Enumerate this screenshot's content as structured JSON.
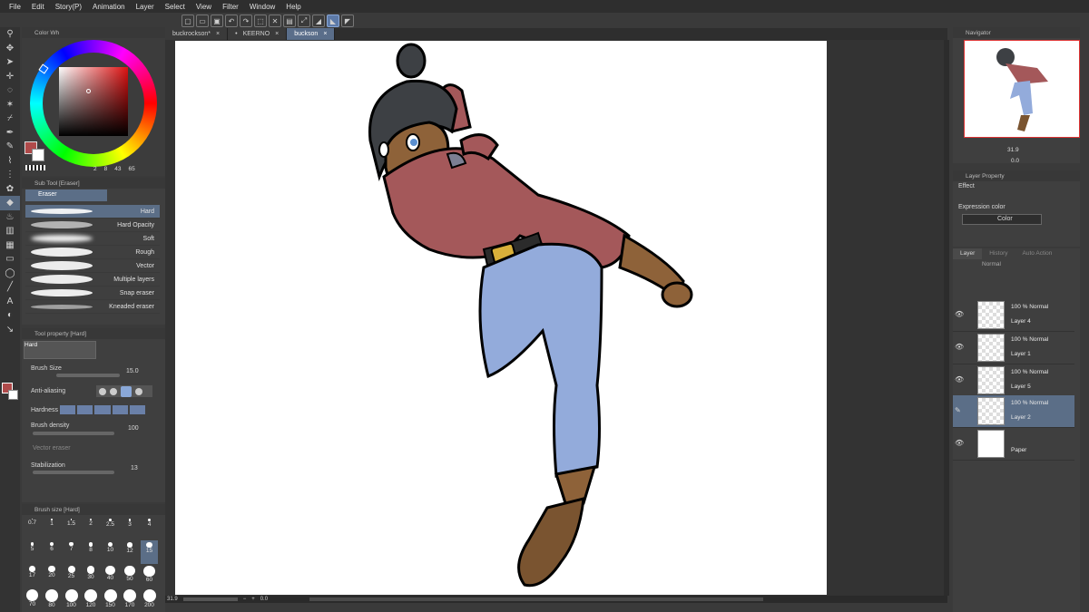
{
  "menu": [
    "File",
    "Edit",
    "Story(P)",
    "Animation",
    "Layer",
    "Select",
    "View",
    "Filter",
    "Window",
    "Help"
  ],
  "color_panel": {
    "title": "Color Wh",
    "values": [
      "2",
      "8",
      "43",
      "65"
    ]
  },
  "sub_tool": {
    "title": "Sub Tool [Eraser]",
    "group": "Eraser",
    "items": [
      "Hard",
      "Hard Opacity",
      "Soft",
      "Rough",
      "Vector",
      "Multiple layers",
      "Snap eraser",
      "Kneaded eraser"
    ]
  },
  "tool_property": {
    "title": "Tool property [Hard]",
    "preset": "Hard",
    "brush_size_label": "Brush Size",
    "brush_size_value": "15.0",
    "anti_aliasing_label": "Anti-aliasing",
    "hardness_label": "Hardness",
    "brush_density_label": "Brush density",
    "brush_density_value": "100",
    "vector_eraser_label": "Vector eraser",
    "stabilization_label": "Stabilization",
    "stabilization_value": "13"
  },
  "brush_size": {
    "title": "Brush size [Hard]",
    "sizes": [
      "0.7",
      "1",
      "1.5",
      "2",
      "2.5",
      "3",
      "4",
      "5",
      "6",
      "7",
      "8",
      "10",
      "12",
      "15",
      "17",
      "20",
      "25",
      "30",
      "40",
      "50",
      "60",
      "70",
      "80",
      "100",
      "120",
      "150",
      "170",
      "200"
    ],
    "selected": "15"
  },
  "tabs": [
    {
      "label": "buckrockson*"
    },
    {
      "label": "KEERNO"
    },
    {
      "label": "buckson"
    }
  ],
  "status": {
    "zoom": "31.9",
    "rotation": "0.0"
  },
  "navigator": {
    "title": "Navigator",
    "zoom": "31.9",
    "rotation": "0.0"
  },
  "layer_property": {
    "title": "Layer Property",
    "effect_label": "Effect",
    "expression_label": "Expression color",
    "expression_value": "Color"
  },
  "layer_panel": {
    "tabs": [
      "Layer",
      "History",
      "Auto Action"
    ],
    "blend": "Normal"
  },
  "layers": [
    {
      "mode": "100 % Normal",
      "name": "Layer 4"
    },
    {
      "mode": "100 % Normal",
      "name": "Layer 1"
    },
    {
      "mode": "100 % Normal",
      "name": "Layer 5"
    },
    {
      "mode": "100 % Normal",
      "name": "Layer 2"
    },
    {
      "mode": "",
      "name": "Paper"
    }
  ],
  "colors": {
    "main": "#b04a4a",
    "sub": "#ffffff",
    "jacket": "#a4585a",
    "jeans": "#93abdb",
    "skin": "#8e6239",
    "hair": "#3d4044",
    "boot": "#7a5430"
  }
}
